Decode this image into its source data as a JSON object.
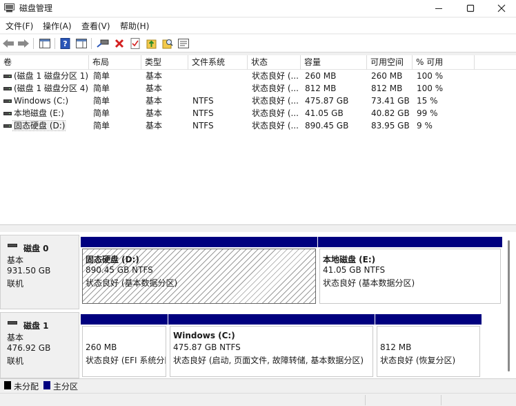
{
  "window": {
    "title": "磁盘管理",
    "icon": "disk-management-icon"
  },
  "menu": [
    {
      "label": "文件(F)"
    },
    {
      "label": "操作(A)"
    },
    {
      "label": "查看(V)"
    },
    {
      "label": "帮助(H)"
    }
  ],
  "toolbar": [
    "back-arrow-icon",
    "forward-arrow-icon",
    "console-view-icon",
    "help-icon",
    "properties-view-icon",
    "connect-disk-icon",
    "delete-icon",
    "check-icon",
    "export-icon",
    "search-icon",
    "properties-icon"
  ],
  "volume_list": {
    "columns": [
      "卷",
      "布局",
      "类型",
      "文件系统",
      "状态",
      "容量",
      "可用空间",
      "% 可用"
    ],
    "rows": [
      {
        "volume": "(磁盘 1 磁盘分区 1)",
        "layout": "简单",
        "type": "基本",
        "fs": "",
        "status": "状态良好 (...",
        "capacity": "260 MB",
        "free": "260 MB",
        "pct": "100 %"
      },
      {
        "volume": "(磁盘 1 磁盘分区 4)",
        "layout": "简单",
        "type": "基本",
        "fs": "",
        "status": "状态良好 (...",
        "capacity": "812 MB",
        "free": "812 MB",
        "pct": "100 %"
      },
      {
        "volume": "Windows (C:)",
        "layout": "简单",
        "type": "基本",
        "fs": "NTFS",
        "status": "状态良好 (...",
        "capacity": "475.87 GB",
        "free": "73.41 GB",
        "pct": "15 %"
      },
      {
        "volume": "本地磁盘 (E:)",
        "layout": "简单",
        "type": "基本",
        "fs": "NTFS",
        "status": "状态良好 (...",
        "capacity": "41.05 GB",
        "free": "40.82 GB",
        "pct": "99 %"
      },
      {
        "volume": "固态硬盘 (D:)",
        "layout": "简单",
        "type": "基本",
        "fs": "NTFS",
        "status": "状态良好 (...",
        "capacity": "890.45 GB",
        "free": "83.95 GB",
        "pct": "9 %"
      }
    ]
  },
  "disks": [
    {
      "name": "磁盘 0",
      "type": "基本",
      "size": "931.50 GB",
      "status": "联机",
      "partitions": [
        {
          "title": "固态硬盘 (D:)",
          "size": "890.45 GB NTFS",
          "status": "状态良好 (基本数据分区)",
          "selected": true
        },
        {
          "title": "本地磁盘 (E:)",
          "size": "41.05 GB NTFS",
          "status": "状态良好 (基本数据分区)",
          "selected": false
        }
      ]
    },
    {
      "name": "磁盘 1",
      "type": "基本",
      "size": "476.92 GB",
      "status": "联机",
      "partitions": [
        {
          "title": "",
          "size": "260 MB",
          "status": "状态良好 (EFI 系统分区)"
        },
        {
          "title": "Windows (C:)",
          "size": "475.87 GB NTFS",
          "status": "状态良好 (启动, 页面文件, 故障转储, 基本数据分区)"
        },
        {
          "title": "",
          "size": "812 MB",
          "status": "状态良好 (恢复分区)"
        }
      ]
    }
  ],
  "legend": [
    {
      "label": "未分配",
      "color": "#000000"
    },
    {
      "label": "主分区",
      "color": "#00007f"
    }
  ],
  "colors": {
    "primary_partition": "#00007f",
    "unallocated": "#000000"
  }
}
